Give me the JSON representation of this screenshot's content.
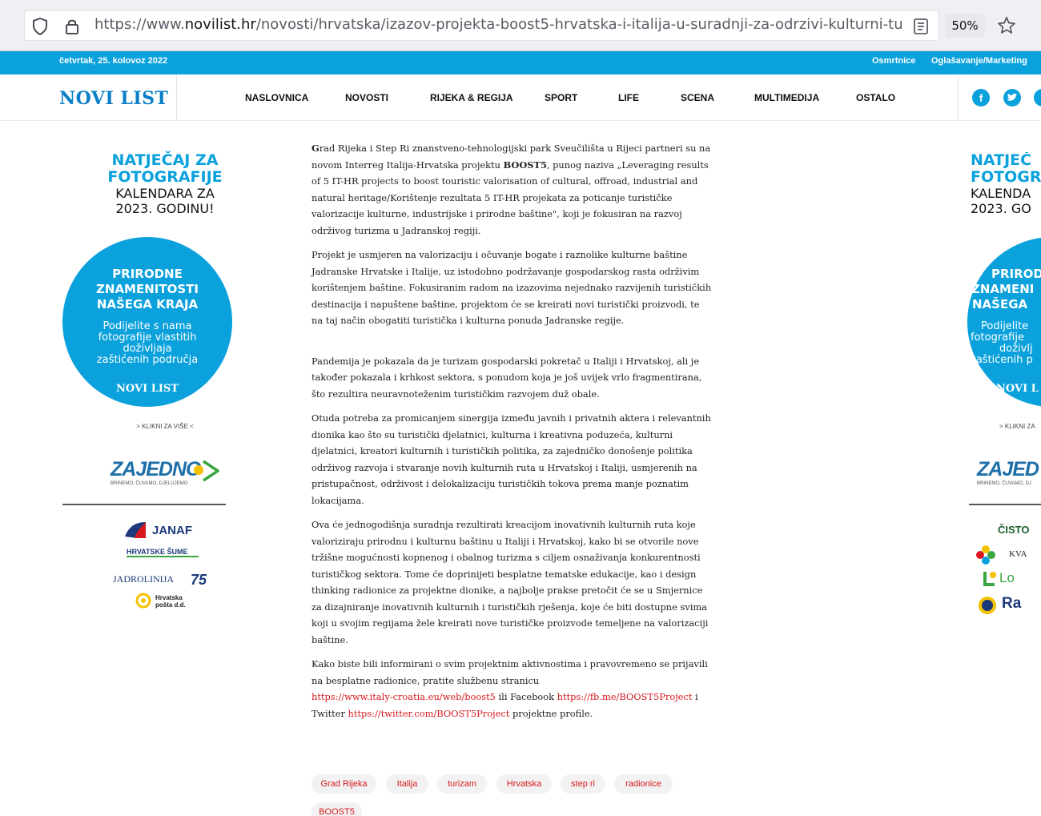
{
  "browser": {
    "url_prefix": "https://www.",
    "url_domain": "novilist.hr",
    "url_path": "/novosti/hrvatska/izazov-projekta-boost5-hrvatska-i-italija-u-suradnji-za-odrzivi-kulturni-turi",
    "zoom": "50%"
  },
  "topbar": {
    "date": "četvrtak, 25. kolovoz 2022",
    "links": [
      "Osmrtnice",
      "Oglašavanje/Marketing"
    ]
  },
  "nav": {
    "logo": "NOVI LIST",
    "items": [
      "NASLOVNICA",
      "NOVOSTI",
      "RIJEKA & REGIJA",
      "SPORT",
      "LIFE",
      "SCENA",
      "MULTIMEDIJA",
      "OSTALO"
    ],
    "social": [
      "facebook-icon",
      "twitter-icon",
      "instagram-icon"
    ]
  },
  "ad_left": {
    "title_lines": [
      "NATJEČAJ ZA",
      "FOTOGRAFIJE"
    ],
    "sub_lines": [
      "KALENDARA ZA",
      "2023. GODINU!"
    ],
    "circle_title": [
      "PRIRODNE",
      "ZNAMENITOSTI",
      "NAŠEGA KRAJA"
    ],
    "circle_text": [
      "Podijelite s nama",
      "fotografije vlastitih",
      "doživljaja",
      "zaštićenih područja"
    ],
    "circle_logo": "NOVI LIST",
    "cta": "> KLIKNI ZA VIŠE <",
    "zajedno": "ZAJEDNO",
    "zajedno_sub": "BRINEMO, ČUVAMO, DJELUJEMO",
    "sponsors": [
      "JANAF",
      "HRVATSKE ŠUME",
      "JADROLINIJA",
      "Hrvatska pošta d.d."
    ]
  },
  "ad_right": {
    "title_lines": [
      "NATJEČ",
      "FOTOGR"
    ],
    "sub_lines": [
      "KALENDA",
      "2023. GO"
    ],
    "circle_title": [
      "PRIROD",
      "ZNAMENI",
      "NAŠEGA"
    ],
    "circle_text": [
      "Podijelite",
      "fotografije",
      "doživlj",
      "zaštićenih p"
    ],
    "circle_logo": "NOVI L",
    "cta": "> KLIKNI ZA",
    "zajedno": "ZAJED",
    "zajedno_sub": "BRINEMO, ČUVAMO, DJ",
    "sponsors": [
      "ČISTO",
      "KVA",
      "Lo",
      "Ra"
    ]
  },
  "article": {
    "p1_bold": "G",
    "p1_a": "rad Rijeka i Step Ri znanstveno-tehnologijski park Sveučilišta u Rijeci partneri su na novom Interreg Italija-Hrvatska projektu ",
    "p1_b": "BOOST5",
    "p1_c": ", punog naziva „Leveraging results of 5 IT-HR projects to boost touristic valorisation of cultural, offroad, industrial and natural heritage/Korištenje rezultata 5 IT-HR projekata za poticanje turističke valorizacije kulturne, industrijske i prirodne baštine\", koji je fokusiran na razvoj održivog turizma u Jadranskoj regiji.",
    "p2": "Projekt je usmjeren na valorizaciju i očuvanje bogate i raznolike kulturne baštine Jadranske Hrvatske i Italije, uz istodobno podržavanje gospodarskog rasta održivim korištenjem baštine. Fokusiranim radom na izazovima nejednako razvijenih turističkih destinacija i napuštene baštine, projektom će se kreirati novi turistički proizvodi, te na taj način obogatiti turistička i kulturna ponuda Jadranske regije.",
    "p3": "Pandemija je pokazala da je turizam gospodarski pokretač u Italiji i Hrvatskoj, ali je također pokazala i krhkost sektora, s ponudom koja je još uvijek vrlo fragmentirana, što rezultira neuravnoteženim turističkim razvojem duž obale.",
    "p4": "Otuda potreba za promicanjem sinergija između javnih i privatnih aktera i relevantnih dionika kao što su turistički djelatnici, kulturna i kreativna poduzeća, kulturni djelatnici, kreatori kulturnih i turističkih politika, za zajedničko donošenje politika održivog razvoja i stvaranje novih kulturnih ruta u Hrvatskoj i Italiji, usmjerenih na pristupačnost, održivost i delokalizaciju turističkih tokova prema manje poznatim lokacijama.",
    "p5": "Ova će jednogodišnja suradnja rezultirati kreacijom inovativnih kulturnih ruta koje valoriziraju prirodnu i kulturnu baštinu u Italiji i Hrvatskoj, kako bi se otvorile nove tržišne mogućnosti kopnenog i obalnog turizma s ciljem osnaživanja konkurentnosti turističkog sektora. Tome će doprinijeti besplatne tematske edukacije, kao i design thinking radionice za projektne dionike, a najbolje prakse pretočit će se u Smjernice za dizajniranje inovativnih kulturnih i turističkih rješenja, koje će biti dostupne svima koji u svojim regijama žele kreirati nove turističke proizvode temeljene na valorizaciji baštine.",
    "p6_a": "Kako biste bili informirani o svim projektnim aktivnostima i pravovremeno se prijavili na besplatne radionice, pratite službenu stranicu ",
    "link1": "https://www.italy-croatia.eu/web/boost5",
    "p6_b": " ili Facebook ",
    "link2": "https://fb.me/BOOST5Project",
    "p6_c": " i Twitter ",
    "link3": "https://twitter.com/BOOST5Project",
    "p6_d": " projektne profile."
  },
  "tags": [
    "Grad Rijeka",
    "Italija",
    "turizam",
    "Hrvatska",
    "step ri",
    "radionice",
    "BOOST5"
  ],
  "colors": {
    "brand_blue": "#0aa1dc",
    "logo_blue": "#0a7fc8",
    "link_red": "#d6191e"
  }
}
